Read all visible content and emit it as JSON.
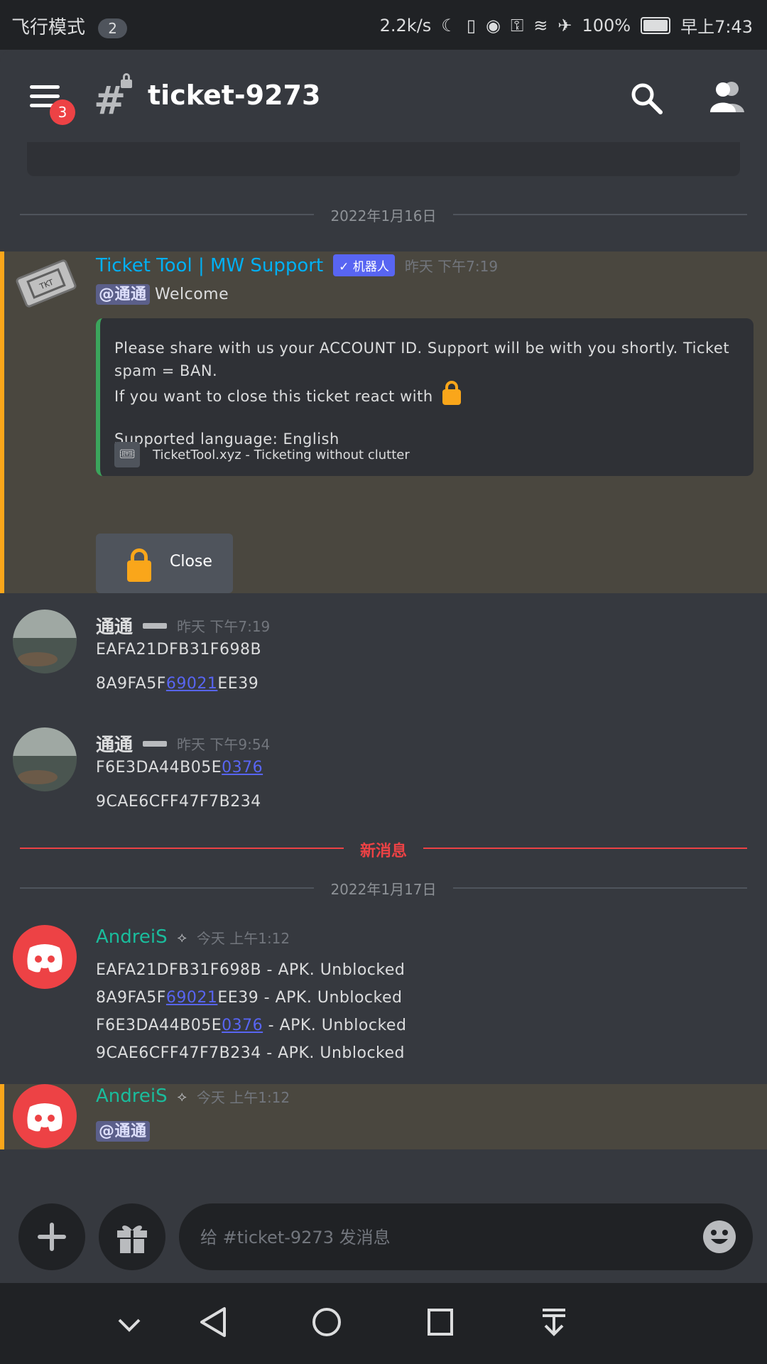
{
  "status_bar": {
    "left_text": "飞行模式",
    "notification_count": "2",
    "network_speed": "2.2k/s",
    "battery": "100%",
    "time": "早上7:43"
  },
  "header": {
    "menu_badge": "3",
    "channel_name": "ticket-9273"
  },
  "dates": {
    "first": "2022年1月16日",
    "second": "2022年1月17日"
  },
  "new_messages_label": "新消息",
  "messages": {
    "bot": {
      "username": "Ticket Tool | MW Support",
      "bot_tag": "机器人",
      "timestamp": "昨天 下午7:19",
      "mention": "@通通",
      "text": "Welcome",
      "embed_line1": "Please share with us your ACCOUNT ID. Support will be with you shortly. Ticket spam = BAN.",
      "embed_line2": "If you want to close this ticket react with",
      "embed_line3": "Supported language: English",
      "embed_footer": "TicketTool.xyz - Ticketing without clutter",
      "close_button": "Close"
    },
    "user1": {
      "username": "通通",
      "timestamp": "昨天 下午7:19",
      "line1": "EAFA21DFB31F698B",
      "line2_pre": "8A9FA5F",
      "line2_link": "69021",
      "line2_post": "EE39"
    },
    "user2": {
      "username": "通通",
      "timestamp": "昨天 下午9:54",
      "line1_pre": "F6E3DA44B05E",
      "line1_link": "0376",
      "line2": "9CAE6CFF47F7B234"
    },
    "andrei1": {
      "username": "AndreiS",
      "timestamp": "今天 上午1:12",
      "line1": "EAFA21DFB31F698B - APK. Unblocked",
      "line2_pre": "8A9FA5F",
      "line2_link": "69021",
      "line2_post": "EE39 - APK. Unblocked",
      "line3_pre": "F6E3DA44B05E",
      "line3_link": "0376",
      "line3_post": " - APK. Unblocked",
      "line4": "9CAE6CFF47F7B234 - APK. Unblocked"
    },
    "andrei2": {
      "username": "AndreiS",
      "timestamp": "今天 上午1:12",
      "mention": "@通通"
    }
  },
  "input": {
    "placeholder": "给 #ticket-9273 发消息"
  },
  "colors": {
    "background": "#36393f",
    "mention_highlight": "#4a473f",
    "mention_bar": "#faa61a",
    "link": "#5865f2",
    "bot_name": "#00b0f4",
    "andrei_name": "#1abc9c",
    "new_messages": "#ed4245"
  }
}
